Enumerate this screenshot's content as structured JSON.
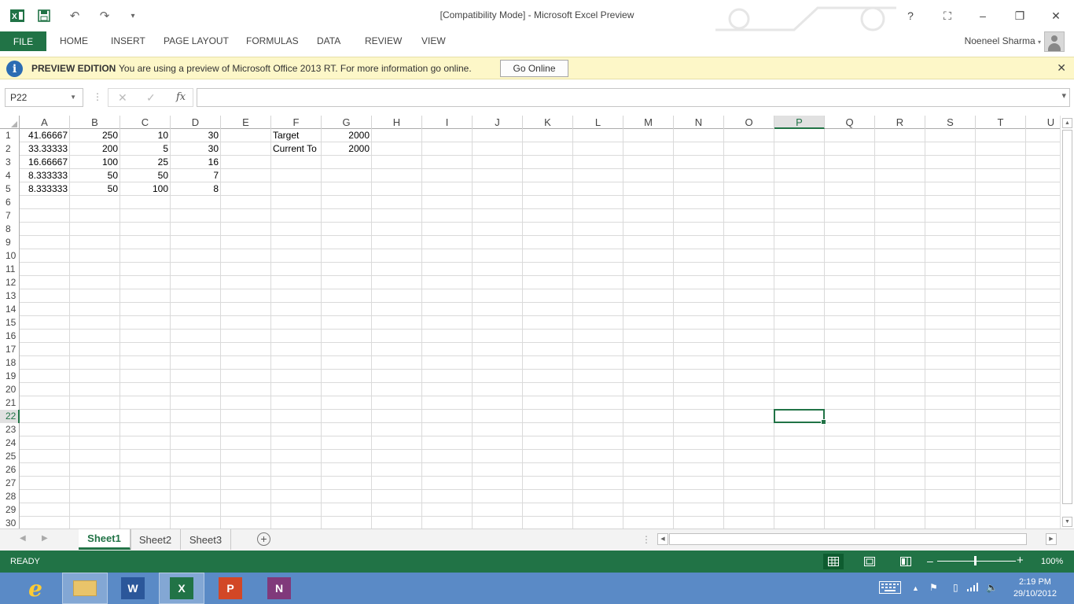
{
  "window": {
    "title": "[Compatibility Mode] - Microsoft Excel Preview",
    "help": "?",
    "minimize": "–",
    "restore": "❐",
    "close": "✕"
  },
  "ribbon": {
    "file": "FILE",
    "tabs": [
      "HOME",
      "INSERT",
      "PAGE LAYOUT",
      "FORMULAS",
      "DATA",
      "REVIEW",
      "VIEW"
    ],
    "user": "Noeneel Sharma"
  },
  "preview_bar": {
    "label": "PREVIEW EDITION",
    "message": "You are using a preview of Microsoft Office 2013 RT. For more information go online.",
    "button": "Go Online",
    "close": "✕"
  },
  "formula_bar": {
    "name_box": "P22",
    "cancel": "✕",
    "enter": "✓",
    "fx": "fx",
    "content": ""
  },
  "sheet": {
    "columns": [
      "A",
      "B",
      "C",
      "D",
      "E",
      "F",
      "G",
      "H",
      "I",
      "J",
      "K",
      "L",
      "M",
      "N",
      "O",
      "P",
      "Q",
      "R",
      "S",
      "T",
      "U"
    ],
    "selected_column": "P",
    "rows": [
      "1",
      "2",
      "3",
      "4",
      "5",
      "6",
      "7",
      "8",
      "9",
      "10",
      "11",
      "12",
      "13",
      "14",
      "15",
      "16",
      "17",
      "18",
      "19",
      "20",
      "21",
      "22",
      "23",
      "24",
      "25",
      "26",
      "27",
      "28",
      "29",
      "30"
    ],
    "selected_row": "22",
    "cells": [
      {
        "ref": "A1",
        "value": "41.66667",
        "numeric": true
      },
      {
        "ref": "B1",
        "value": "250",
        "numeric": true
      },
      {
        "ref": "C1",
        "value": "10",
        "numeric": true
      },
      {
        "ref": "D1",
        "value": "30",
        "numeric": true
      },
      {
        "ref": "F1",
        "value": "Target",
        "numeric": false
      },
      {
        "ref": "G1",
        "value": "2000",
        "numeric": true
      },
      {
        "ref": "A2",
        "value": "33.33333",
        "numeric": true
      },
      {
        "ref": "B2",
        "value": "200",
        "numeric": true
      },
      {
        "ref": "C2",
        "value": "5",
        "numeric": true
      },
      {
        "ref": "D2",
        "value": "30",
        "numeric": true
      },
      {
        "ref": "F2",
        "value": "Current To",
        "numeric": false
      },
      {
        "ref": "G2",
        "value": "2000",
        "numeric": true
      },
      {
        "ref": "A3",
        "value": "16.66667",
        "numeric": true
      },
      {
        "ref": "B3",
        "value": "100",
        "numeric": true
      },
      {
        "ref": "C3",
        "value": "25",
        "numeric": true
      },
      {
        "ref": "D3",
        "value": "16",
        "numeric": true
      },
      {
        "ref": "A4",
        "value": "8.333333",
        "numeric": true
      },
      {
        "ref": "B4",
        "value": "50",
        "numeric": true
      },
      {
        "ref": "C4",
        "value": "50",
        "numeric": true
      },
      {
        "ref": "D4",
        "value": "7",
        "numeric": true
      },
      {
        "ref": "A5",
        "value": "8.333333",
        "numeric": true
      },
      {
        "ref": "B5",
        "value": "50",
        "numeric": true
      },
      {
        "ref": "C5",
        "value": "100",
        "numeric": true
      },
      {
        "ref": "D5",
        "value": "8",
        "numeric": true
      }
    ],
    "active_cell": "P22"
  },
  "sheet_tabs": {
    "tabs": [
      "Sheet1",
      "Sheet2",
      "Sheet3"
    ],
    "active": "Sheet1",
    "add": "+"
  },
  "status_bar": {
    "status": "READY",
    "zoom": "100%"
  },
  "taskbar": {
    "time": "2:19 PM",
    "date": "29/10/2012"
  },
  "colors": {
    "excel_green": "#217346",
    "preview_bar": "#fdf7c8",
    "taskbar": "#5a8ac6"
  }
}
